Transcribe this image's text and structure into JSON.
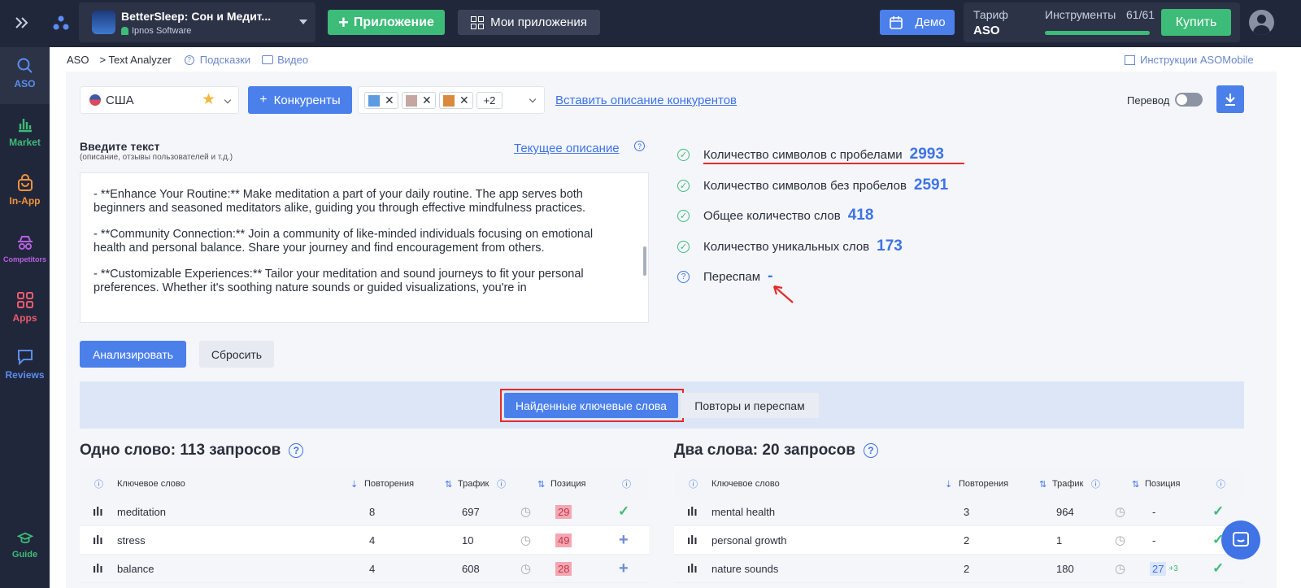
{
  "app": {
    "name": "BetterSleep: Сон и Медит...",
    "developer": "Ipnos Software"
  },
  "top": {
    "add_app": "Приложение",
    "my_apps": "Мои приложения",
    "demo": "Демо",
    "tariff_label": "Тариф",
    "tariff_value": "ASO",
    "tools_label": "Инструменты",
    "tools_count": "61/61",
    "tools_progress": 1.0,
    "buy": "Купить"
  },
  "sidebar": [
    {
      "label": "ASO",
      "icon": "search-icon",
      "color": "#5b8def"
    },
    {
      "label": "Market",
      "icon": "bar-chart-icon",
      "color": "#3dbb78"
    },
    {
      "label": "In-App",
      "icon": "bag-icon",
      "color": "#f0933f"
    },
    {
      "label": "Competitors",
      "icon": "spy-icon",
      "color": "#b660e0"
    },
    {
      "label": "Apps",
      "icon": "grid-icon",
      "color": "#ea5a6e"
    },
    {
      "label": "Reviews",
      "icon": "chat-icon",
      "color": "#5b8def"
    },
    {
      "label": "Guide",
      "icon": "graduation-cap-icon",
      "color": "#3dbb78"
    }
  ],
  "breadcrumb": {
    "root": "ASO",
    "page": "> Text Analyzer",
    "hints": "Подсказки",
    "video": "Видео",
    "instructions": "Инструкции ASOMobile"
  },
  "controls": {
    "country": "США",
    "competitors_btn": "Конкуренты",
    "competitors_more": "+2",
    "insert_desc": "Вставить описание конкурентов",
    "translate": "Перевод"
  },
  "input": {
    "title": "Введите текст",
    "subtitle": "(описание, отзывы пользователей и т.д.)",
    "current_desc": "Текущее описание",
    "paragraphs": [
      "- **Enhance Your Routine:** Make meditation a part of your daily routine. The app serves both beginners and seasoned meditators alike, guiding you through effective mindfulness practices.",
      "- **Community Connection:** Join a community of like-minded individuals focusing on emotional health and personal balance. Share your journey and find encouragement from others.",
      "- **Customizable Experiences:** Tailor your meditation and sound journeys to fit your personal preferences. Whether it's soothing nature sounds or guided visualizations, you're in"
    ],
    "analyze": "Анализировать",
    "reset": "Сбросить"
  },
  "stats": [
    {
      "label": "Количество символов с пробелами",
      "value": "2993"
    },
    {
      "label": "Количество символов без пробелов",
      "value": "2591"
    },
    {
      "label": "Общее количество слов",
      "value": "418"
    },
    {
      "label": "Количество уникальных слов",
      "value": "173"
    },
    {
      "label": "Переспам",
      "value": "-"
    }
  ],
  "tabs": {
    "found": "Найденные ключевые слова",
    "repeats": "Повторы и переспам"
  },
  "one_word": {
    "title": "Одно слово: 113 запросов",
    "headers": {
      "keyword": "Ключевое слово",
      "repeats": "Повторения",
      "traffic": "Трафик",
      "position": "Позиция"
    },
    "rows": [
      {
        "keyword": "meditation",
        "repeats": "8",
        "traffic": "697",
        "position": "29",
        "action": "check"
      },
      {
        "keyword": "stress",
        "repeats": "4",
        "traffic": "10",
        "position": "49",
        "action": "plus"
      },
      {
        "keyword": "balance",
        "repeats": "4",
        "traffic": "608",
        "position": "28",
        "action": "plus"
      }
    ]
  },
  "two_words": {
    "title": "Два слова: 20 запросов",
    "headers": {
      "keyword": "Ключевое слово",
      "repeats": "Повторения",
      "traffic": "Трафик",
      "position": "Позиция"
    },
    "rows": [
      {
        "keyword": "mental health",
        "repeats": "3",
        "traffic": "964",
        "position": "-",
        "action": "check"
      },
      {
        "keyword": "personal growth",
        "repeats": "2",
        "traffic": "1",
        "position": "-",
        "action": "check"
      },
      {
        "keyword": "nature sounds",
        "repeats": "2",
        "traffic": "180",
        "position": "27",
        "delta": "+3",
        "action": "check"
      }
    ]
  }
}
